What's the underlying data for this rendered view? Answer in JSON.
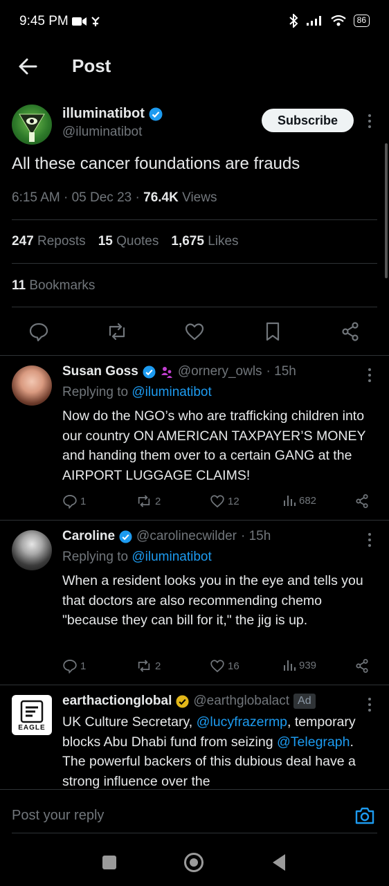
{
  "status_bar": {
    "time": "9:45 PM",
    "battery": "86"
  },
  "header": {
    "title": "Post"
  },
  "post": {
    "author_name": "illuminatibot",
    "author_handle": "@iluminatibot",
    "subscribe_label": "Subscribe",
    "text": "All these cancer foundations are frauds",
    "time": "6:15 AM",
    "date": "05 Dec 23",
    "views_count": "76.4K",
    "views_label": "Views",
    "reposts_count": "247",
    "reposts_label": "Reposts",
    "quotes_count": "15",
    "quotes_label": "Quotes",
    "likes_count": "1,675",
    "likes_label": "Likes",
    "bookmarks_count": "11",
    "bookmarks_label": "Bookmarks"
  },
  "replies": [
    {
      "name": "Susan Goss",
      "handle": "@ornery_owls",
      "age": "· 15h",
      "replying_prefix": "Replying to",
      "replying_to": "@iluminatibot",
      "text": "Now do the NGO’s who are trafficking children into our country ON AMERICAN TAXPAYER’S MONEY and handing them over to a certain GANG at the AIRPORT LUGGAGE CLAIMS!",
      "replies": "1",
      "reposts": "2",
      "likes": "12",
      "views": "682"
    },
    {
      "name": "Caroline",
      "handle": "@carolinecwilder",
      "age": "· 15h",
      "replying_prefix": "Replying to",
      "replying_to": "@iluminatibot",
      "text": "When a resident looks you in the eye and tells you that doctors are also recommending chemo \"because they can bill for it,\" the jig is up.",
      "replies": "1",
      "reposts": "2",
      "likes": "16",
      "views": "939"
    },
    {
      "name": "earthactionglobal",
      "handle": "@earthglobalact",
      "ad_label": "Ad",
      "avatar_text": "EAGLE",
      "text_1": "UK Culture Secretary, ",
      "mention_1": "@lucyfrazermp",
      "text_2": ", temporary blocks Abu Dhabi fund from seizing ",
      "mention_2": "@Telegraph",
      "text_3": ". The powerful backers of this dubious deal have a strong influence over the"
    }
  ],
  "reply_bar": {
    "placeholder": "Post your reply"
  },
  "colors": {
    "accent": "#1d9bf0",
    "verified_gold": "#e2b719",
    "muted": "#71767b"
  }
}
